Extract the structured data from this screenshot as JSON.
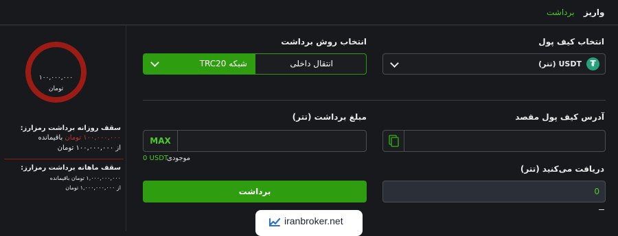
{
  "tabs": [
    {
      "label": "واریز"
    },
    {
      "label": "برداشت"
    }
  ],
  "wallet": {
    "label": "انتخاب کیف پول",
    "selected": "USDT (تتر)",
    "coin_icon": "tether-icon",
    "coin_symbol": "₮"
  },
  "method": {
    "label": "انتخاب روش برداشت",
    "option_internal": "انتقال داخلی",
    "option_network": "شبکه TRC20"
  },
  "address": {
    "label": "آدرس کیف پول مقصد",
    "value": "",
    "paste_icon": "paste-icon"
  },
  "amount": {
    "label": "مبلغ برداشت (تتر)",
    "value": "",
    "max_label": "MAX",
    "balance_label": "موجودی",
    "balance_value": "0 USDT"
  },
  "receive": {
    "label": "دریافت می‌کنید (تتر)",
    "value": "0"
  },
  "submit": {
    "label": "برداشت"
  },
  "limits": {
    "gauge_amount": "۱۰۰,۰۰۰,۰۰۰",
    "gauge_unit": "تومان",
    "gauge_fraction_used": 1.0,
    "daily_title": "سقف روزانه برداشت رمزارز:",
    "daily_remaining_value": "۱۰۰,۰۰۰,۰۰۰ تومان",
    "daily_remaining_label": "باقیمانده",
    "daily_total": "از ۱۰۰,۰۰۰,۰۰۰ تومان",
    "monthly_title": "سقف ماهانه برداشت رمزارز:",
    "monthly_remaining": "۱,۰۰۰,۰۰۰,۰۰۰ تومان باقیمانده",
    "monthly_total": "از ۱,۰۰۰,۰۰۰,۰۰۰ تومان"
  },
  "watermark": {
    "text": "iranbroker.net"
  },
  "colors": {
    "accent_green": "#2e9d10",
    "gauge_red": "#9b1c14",
    "tether_green": "#26a17b"
  }
}
